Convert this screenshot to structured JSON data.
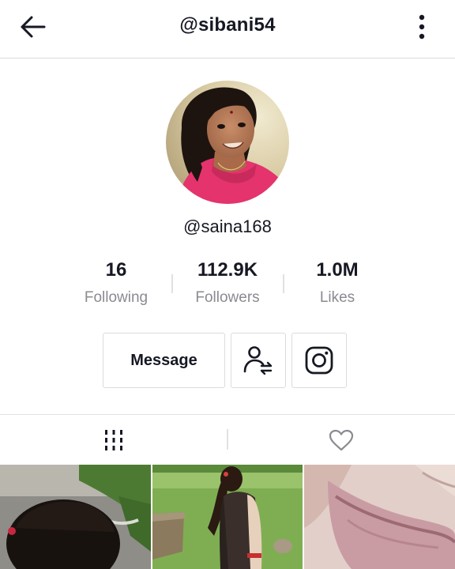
{
  "header": {
    "title": "@sibani54",
    "back_icon": "arrow-left-icon",
    "more_icon": "more-vertical-icon"
  },
  "profile": {
    "username": "@saina168",
    "stats": [
      {
        "value": "16",
        "label": "Following"
      },
      {
        "value": "112.9K",
        "label": "Followers"
      },
      {
        "value": "1.0M",
        "label": "Likes"
      }
    ]
  },
  "actions": {
    "message_label": "Message",
    "follow_icon": "user-swap-icon",
    "instagram_icon": "instagram-icon"
  },
  "tabs": [
    {
      "name": "videos",
      "icon": "grid-icon",
      "active": true
    },
    {
      "name": "liked",
      "icon": "heart-icon",
      "active": false
    }
  ],
  "colors": {
    "text": "#161823",
    "secondary_text": "#8a8b91",
    "border": "#dcdcdf"
  }
}
